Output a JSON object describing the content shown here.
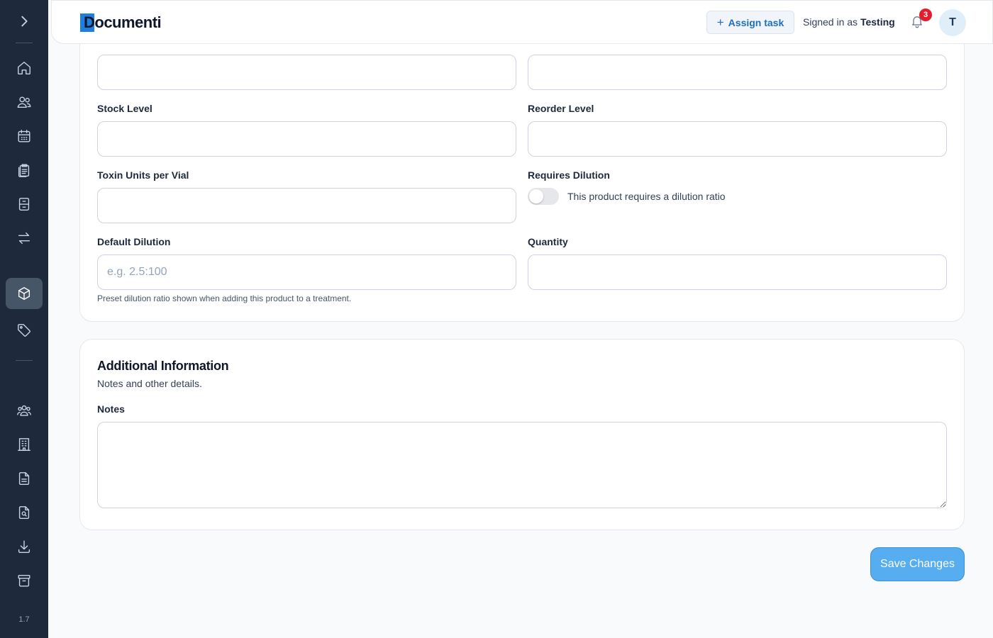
{
  "app": {
    "brand": "Documenti",
    "version": "1.7"
  },
  "header": {
    "assign_task_label": "Assign task",
    "signed_in_prefix": "Signed in as",
    "signed_in_user": "Testing",
    "notification_count": "3",
    "avatar_initial": "T"
  },
  "sidebar": {
    "expand_icon": "chevron-right-icon",
    "items": [
      {
        "icon": "home-icon",
        "active": false
      },
      {
        "icon": "users-icon",
        "active": false
      },
      {
        "icon": "calendar-icon",
        "active": false
      },
      {
        "icon": "clipboard-icon",
        "active": false
      },
      {
        "icon": "cabinet-icon",
        "active": false
      },
      {
        "icon": "transfer-icon",
        "active": false
      },
      {
        "icon": "cube-icon",
        "active": true
      },
      {
        "icon": "tag-icon",
        "active": false
      },
      {
        "icon": "group-icon",
        "active": false
      },
      {
        "icon": "building-icon",
        "active": false
      },
      {
        "icon": "document-icon",
        "active": false
      },
      {
        "icon": "document-search-icon",
        "active": false
      },
      {
        "icon": "download-icon",
        "active": false
      },
      {
        "icon": "archive-icon",
        "active": false
      }
    ]
  },
  "pricing": {
    "stock_level_label": "Stock Level",
    "reorder_level_label": "Reorder Level",
    "toxin_units_label": "Toxin Units per Vial",
    "requires_dilution_label": "Requires Dilution",
    "requires_dilution_toggle_text": "This product requires a dilution ratio",
    "default_dilution_label": "Default Dilution",
    "default_dilution_placeholder": "e.g. 2.5:100",
    "default_dilution_help": "Preset dilution ratio shown when adding this product to a treatment.",
    "quantity_label": "Quantity"
  },
  "additional": {
    "title": "Additional Information",
    "subtitle": "Notes and other details.",
    "notes_label": "Notes"
  },
  "actions": {
    "save_label": "Save Changes"
  },
  "colors": {
    "sidebar_bg": "#1e293b",
    "accent": "#56adf0",
    "badge": "#e11d2e"
  }
}
